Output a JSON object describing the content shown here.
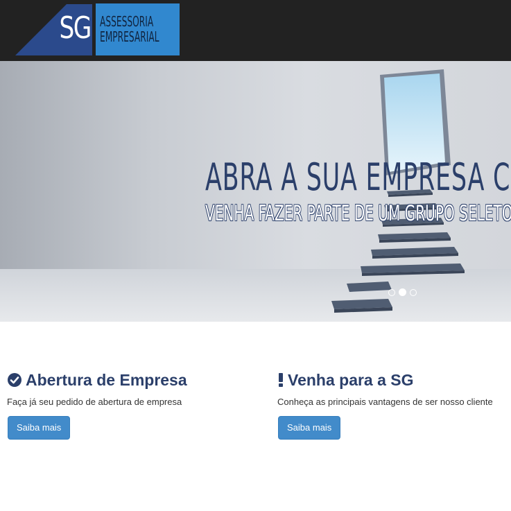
{
  "colors": {
    "header_bg": "#222222",
    "logo_navy": "#2b4a8c",
    "logo_blue": "#3188cf",
    "heading_navy": "#2b3f6a",
    "button_blue": "#428bca"
  },
  "logo": {
    "initials": "SG",
    "line1": "ASSESSORIA",
    "line2": "EMPRESARIAL"
  },
  "hero": {
    "title": "ABRA A SUA EMPRESA CO",
    "subtitle": "VENHA FAZER PARTE DE UM GRUPO SELETO D",
    "slides": 3,
    "active_slide": 2
  },
  "features": [
    {
      "icon": "check-circle-icon",
      "title": "Abertura de Empresa",
      "text": "Faça já seu pedido de abertura de empresa",
      "button": "Saiba mais"
    },
    {
      "icon": "exclamation-icon",
      "title": "Venha para a SG",
      "text": "Conheça as principais vantagens de ser nosso cliente",
      "button": "Saiba mais"
    }
  ]
}
